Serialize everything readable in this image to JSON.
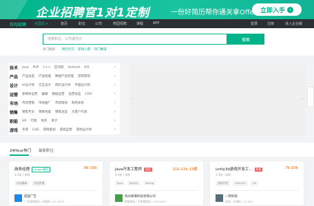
{
  "banner": {
    "headline": "企业招聘官1对1定制",
    "sub": "一份好简历帮你通关拿Offer",
    "cta": "立即入手",
    "cta_arrow": "›"
  },
  "nav": {
    "logo": "拉勾招聘",
    "city": "全国站 ▾",
    "items": [
      "首页",
      "职位",
      "公司",
      "校园招聘",
      "课程",
      "APP"
    ],
    "right": [
      "登录",
      "注册",
      "进入企业版"
    ]
  },
  "search": {
    "placeholder": "搜索职位、公司或地点",
    "button": "搜索",
    "hot_label": "热门搜索：",
    "hot_items": [
      "简历代写",
      "职场入职",
      "热门赛道"
    ]
  },
  "categories": [
    {
      "title": "技术",
      "items": [
        "Java",
        "PHP",
        "C++",
        "区块链",
        "Android",
        "iOS"
      ]
    },
    {
      "title": "产品",
      "items": [
        "产品总监",
        "产品经理",
        "数据产品经理",
        "游戏策划"
      ]
    },
    {
      "title": "设计",
      "items": [
        "UI设计师",
        "交互设计",
        "网页设计师",
        "平面设计师"
      ]
    },
    {
      "title": "运营",
      "items": [
        "新媒体运营",
        "编辑",
        "数据运营",
        "运营总监",
        "COO"
      ]
    },
    {
      "title": "市场",
      "items": [
        "市场营销",
        "市场推广",
        "市场策划",
        "政府关系"
      ]
    },
    {
      "title": "销售",
      "items": [
        "销售专员",
        "销售经理",
        "销售总监",
        "大客户代表"
      ]
    },
    {
      "title": "职能",
      "items": [
        "HR",
        "行政",
        "财务",
        "审计"
      ]
    },
    {
      "title": "游戏",
      "items": [
        "手游",
        "游戏美术",
        "U3D",
        "游戏策划",
        "游戏运营",
        "游戏设计师"
      ]
    }
  ],
  "carousel": {
    "prev": "‹",
    "next": "›"
  },
  "tabs": [
    "24Hour热门",
    "最新职位"
  ],
  "jobs": [
    {
      "title": "商务经理",
      "badge": "Leader直招",
      "badge_type": "leader",
      "salary": "8k-16k",
      "meta": "3-5年 / 本科",
      "tags": [
        "社交媒体",
        "文化传媒"
      ],
      "company": "成直广告",
      "company_info": "广告营销服务 / 未融资 / 50-150人",
      "logo_color": "#1e88e5"
    },
    {
      "title": "java开发工程师",
      "badge": "急招",
      "badge_type": "urgent",
      "salary": "11k-22k·13薪",
      "meta": "3-5年 / 本科",
      "tags": [
        "Java",
        "MySQL",
        "Spring"
      ],
      "company": "杭州爽满科技有限公司",
      "company_info": "数据服务 / 不需要融资 / 150-500人",
      "logo_color": "#43a047"
    },
    {
      "title": "unity3d游戏开发工...",
      "badge": "急招",
      "badge_type": "urgent",
      "salary": "7k-10k",
      "meta": "1-3年 / 本科",
      "tags": [
        "游戏开发",
        "Unity3D",
        "C#"
      ],
      "company": "一刻科技",
      "company_info": "游戏 / 天使轮 / 15-50人",
      "logo_color": "#546e7a"
    }
  ]
}
